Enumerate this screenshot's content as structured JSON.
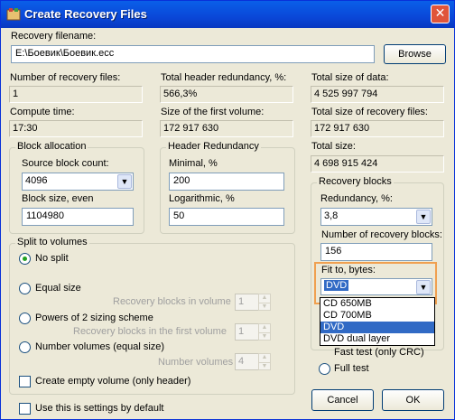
{
  "window": {
    "title": "Create Recovery Files",
    "close_label": "✕"
  },
  "recovery_filename": {
    "label": "Recovery filename:",
    "value": "E:\\Боевик\\Боевик.ecc",
    "browse_label": "Browse"
  },
  "info": {
    "num_recovery_files": {
      "label": "Number of recovery files:",
      "value": "1"
    },
    "total_header_redundancy": {
      "label": "Total header redundancy, %:",
      "value": "566,3%"
    },
    "total_size_data": {
      "label": "Total size of data:",
      "value": "4 525 997 794"
    },
    "compute_time": {
      "label": "Compute time:",
      "value": "17:30"
    },
    "size_first_volume": {
      "label": "Size of the first volume:",
      "value": "172 917 630"
    },
    "total_size_recovery": {
      "label": "Total size of recovery files:",
      "value": "172 917 630"
    },
    "total_size": {
      "label": "Total size:",
      "value": "4 698 915 424"
    }
  },
  "block_allocation": {
    "title": "Block allocation",
    "source_block_count_label": "Source block count:",
    "source_block_count": "4096",
    "block_size_label": "Block size, even",
    "block_size": "1104980"
  },
  "header_redundancy": {
    "title": "Header Redundancy",
    "minimal_label": "Minimal, %",
    "minimal": "200",
    "logarithmic_label": "Logarithmic, %",
    "logarithmic": "50"
  },
  "recovery_blocks": {
    "title": "Recovery blocks",
    "redundancy_label": "Redundancy, %:",
    "redundancy": "3,8",
    "number_label": "Number of recovery blocks:",
    "number": "156",
    "fit_label": "Fit to, bytes:",
    "fit_value": "DVD",
    "fit_options": [
      "CD 650MB",
      "CD 700MB",
      "DVD",
      "DVD dual layer"
    ],
    "fit_selected_index": 2
  },
  "split": {
    "title": "Split to volumes",
    "no_split": "No split",
    "equal_size": "Equal size",
    "recovery_in_volume_label": "Recovery blocks in volume",
    "recovery_in_volume": "1",
    "powers_of_2": "Powers of 2 sizing scheme",
    "recovery_in_first_label": "Recovery blocks in the first volume",
    "recovery_in_first": "1",
    "number_volumes": "Number volumes (equal size)",
    "number_volumes_label": "Number volumes",
    "number_volumes_value": "4",
    "create_empty": "Create empty volume (only header)"
  },
  "test": {
    "fast_test": "Fast test (only CRC)",
    "full_test": "Full test"
  },
  "default_settings": "Use this is settings by default",
  "buttons": {
    "cancel": "Cancel",
    "ok": "OK"
  },
  "colors": {
    "titlebar": "#0a47d8",
    "selection": "#316ac5",
    "highlight_box": "#f0a050"
  }
}
